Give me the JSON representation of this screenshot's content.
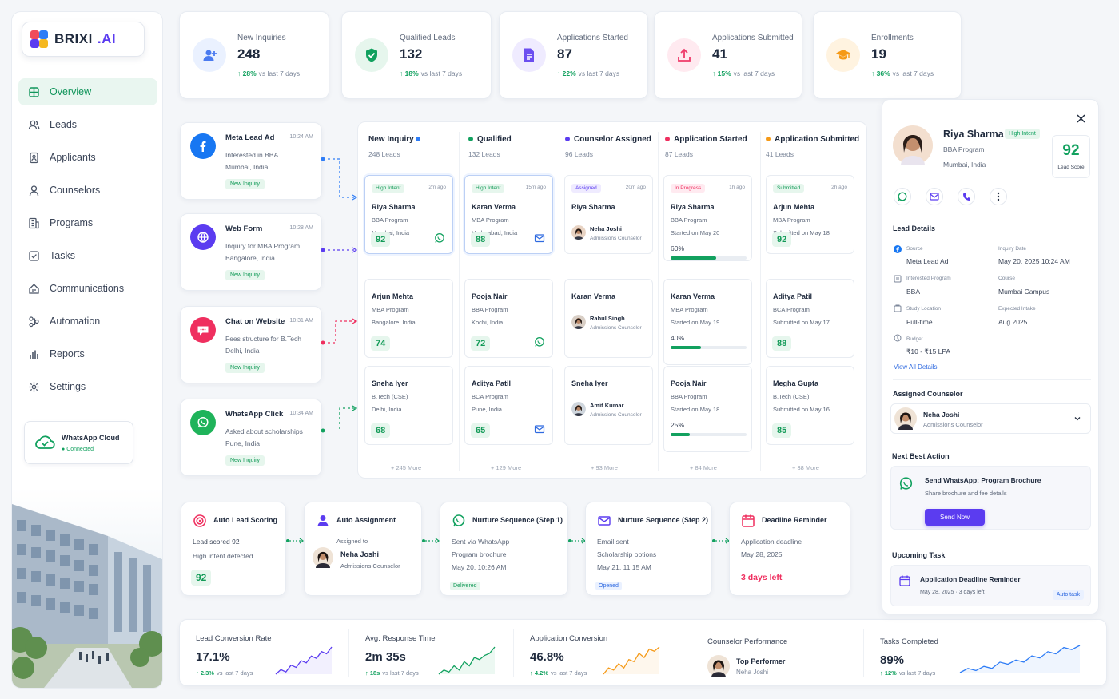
{
  "brand": {
    "name": "BRIXI",
    "suffix": ".AI"
  },
  "nav": [
    {
      "label": "Overview",
      "icon": "grid-icon",
      "active": true
    },
    {
      "label": "Leads",
      "icon": "users-icon"
    },
    {
      "label": "Applicants",
      "icon": "file-user-icon"
    },
    {
      "label": "Counselors",
      "icon": "user-icon"
    },
    {
      "label": "Programs",
      "icon": "building-icon"
    },
    {
      "label": "Tasks",
      "icon": "checkbox-icon"
    },
    {
      "label": "Communications",
      "icon": "message-icon"
    },
    {
      "label": "Automation",
      "icon": "workflow-icon"
    },
    {
      "label": "Reports",
      "icon": "bar-chart-icon"
    },
    {
      "label": "Settings",
      "icon": "gear-icon"
    }
  ],
  "whatsapp_cloud": {
    "title": "WhatsApp Cloud",
    "status": "Connected"
  },
  "kpis": [
    {
      "label": "New Inquiries",
      "value": "248",
      "delta": "28%",
      "period": "vs last 7 days",
      "icon": "user-plus-icon",
      "color": "#4a7bf0",
      "bg": "#eaf1ff"
    },
    {
      "label": "Qualified Leads",
      "value": "132",
      "delta": "18%",
      "period": "vs last 7 days",
      "icon": "shield-check-icon",
      "color": "#12a15f",
      "bg": "#e6f6ed"
    },
    {
      "label": "Applications Started",
      "value": "87",
      "delta": "22%",
      "period": "vs last 7 days",
      "icon": "document-icon",
      "color": "#6b4ef0",
      "bg": "#efebff"
    },
    {
      "label": "Applications Submitted",
      "value": "41",
      "delta": "15%",
      "period": "vs last 7 days",
      "icon": "upload-icon",
      "color": "#ef3b6a",
      "bg": "#ffeaf0"
    },
    {
      "label": "Enrollments",
      "value": "19",
      "delta": "36%",
      "period": "vs last 7 days",
      "icon": "graduation-cap-icon",
      "color": "#f59a18",
      "bg": "#fff3e0"
    }
  ],
  "sources": [
    {
      "title": "Meta Lead Ad",
      "time": "10:24 AM",
      "line1": "Interested in BBA",
      "line2": "Mumbai, India",
      "tag": "New Inquiry",
      "icon": "facebook-icon",
      "color": "#1877f2"
    },
    {
      "title": "Web Form",
      "time": "10:28 AM",
      "line1": "Inquiry for MBA Program",
      "line2": "Bangalore, India",
      "tag": "New Inquiry",
      "icon": "globe-icon",
      "color": "#5b3cf0"
    },
    {
      "title": "Chat on Website",
      "time": "10:31 AM",
      "line1": "Fees structure for B.Tech",
      "line2": "Delhi, India",
      "tag": "New Inquiry",
      "icon": "chat-icon",
      "color": "#ef2f5f"
    },
    {
      "title": "WhatsApp Click",
      "time": "10:34 AM",
      "line1": "Asked about scholarships",
      "line2": "Pune, India",
      "tag": "New Inquiry",
      "icon": "whatsapp-icon",
      "color": "#1fb35a"
    }
  ],
  "pipeline": {
    "columns": [
      {
        "title": "New Inquiry",
        "sub": "248 Leads",
        "dot": "#2f7df6",
        "more": "+ 245 More"
      },
      {
        "title": "Qualified",
        "sub": "132 Leads",
        "dot": "#12a15f",
        "more": "+ 129 More"
      },
      {
        "title": "Counselor Assigned",
        "sub": "96 Leads",
        "dot": "#5b3cf0",
        "more": "+ 93 More"
      },
      {
        "title": "Application Started",
        "sub": "87 Leads",
        "dot": "#ef2f5f",
        "more": "+ 84 More"
      },
      {
        "title": "Application Submitted",
        "sub": "41 Leads",
        "dot": "#f59a18",
        "more": "+ 38 More"
      }
    ],
    "col1": [
      {
        "tag": "High Intent",
        "ago": "2m ago",
        "name": "Riya Sharma",
        "l1": "BBA Program",
        "l2": "Mumbai, India",
        "score": "92",
        "action": "whatsapp-icon"
      },
      {
        "name": "Arjun Mehta",
        "l1": "MBA Program",
        "l2": "Bangalore, India",
        "score": "74"
      },
      {
        "name": "Sneha Iyer",
        "l1": "B.Tech (CSE)",
        "l2": "Delhi, India",
        "score": "68"
      }
    ],
    "col2": [
      {
        "tag": "High Intent",
        "ago": "15m ago",
        "name": "Karan Verma",
        "l1": "MBA Program",
        "l2": "Hyderabad, India",
        "score": "88",
        "action": "mail-icon"
      },
      {
        "name": "Pooja Nair",
        "l1": "BBA Program",
        "l2": "Kochi, India",
        "score": "72",
        "action": "whatsapp-icon"
      },
      {
        "name": "Aditya Patil",
        "l1": "BCA Program",
        "l2": "Pune, India",
        "score": "65",
        "action": "mail-icon"
      }
    ],
    "col3": [
      {
        "tag": "Assigned",
        "ago": "20m ago",
        "name": "Riya Sharma",
        "counselor": "Neha Joshi",
        "role": "Admissions Counselor"
      },
      {
        "name": "Karan Verma",
        "counselor": "Rahul Singh",
        "role": "Admissions Counselor"
      },
      {
        "name": "Sneha Iyer",
        "counselor": "Amit Kumar",
        "role": "Admissions Counselor"
      }
    ],
    "col4": [
      {
        "tag": "In Progress",
        "ago": "1h ago",
        "name": "Riya Sharma",
        "l1": "BBA Program",
        "l2": "Started on May 20",
        "pct": "60%",
        "progress": 0.6
      },
      {
        "name": "Karan Verma",
        "l1": "MBA Program",
        "l2": "Started on May 19",
        "pct": "40%",
        "progress": 0.4
      },
      {
        "name": "Pooja Nair",
        "l1": "BBA Program",
        "l2": "Started on May 18",
        "pct": "25%",
        "progress": 0.25
      }
    ],
    "col5": [
      {
        "tag": "Submitted",
        "ago": "2h ago",
        "name": "Arjun Mehta",
        "l1": "MBA Program",
        "l2": "Submitted on May 18",
        "score": "92"
      },
      {
        "name": "Aditya Patil",
        "l1": "BCA Program",
        "l2": "Submitted on May 17",
        "score": "88"
      },
      {
        "name": "Megha Gupta",
        "l1": "B.Tech (CSE)",
        "l2": "Submitted on May 16",
        "score": "85"
      }
    ]
  },
  "automation": [
    {
      "title": "Auto Lead Scoring",
      "l1": "Lead scored 92",
      "l2": "High intent detected",
      "badge": "92",
      "icon": "target-icon"
    },
    {
      "title": "Auto Assignment",
      "l1": "Assigned to",
      "name": "Neha Joshi",
      "role": "Admissions Counselor",
      "icon": "user-icon"
    },
    {
      "title": "Nurture Sequence (Step 1)",
      "l1": "Sent via WhatsApp",
      "l2": "Program brochure",
      "l3": "May 20, 10:26 AM",
      "badge": "Delivered",
      "icon": "whatsapp-icon"
    },
    {
      "title": "Nurture Sequence (Step 2)",
      "l1": "Email sent",
      "l2": "Scholarship options",
      "l3": "May 21, 11:15 AM",
      "badge": "Opened",
      "icon": "mail-icon"
    },
    {
      "title": "Deadline Reminder",
      "l1": "Application deadline",
      "l2": "May 28, 2025",
      "l3": "3 days left",
      "icon": "calendar-icon"
    }
  ],
  "metrics": [
    {
      "label": "Lead Conversion Rate",
      "value": "17.1%",
      "delta": "2.3%",
      "period": "vs last 7 days",
      "color": "#5b3cf0",
      "trend": [
        3,
        4,
        3.5,
        5,
        4.5,
        6,
        5.5,
        7,
        6.5,
        8,
        7.5,
        9
      ]
    },
    {
      "label": "Avg. Response Time",
      "value": "2m 35s",
      "delta": "18s",
      "period": "vs last 7 days",
      "color": "#12a15f",
      "trend": [
        2,
        3,
        2.5,
        4,
        3,
        5,
        4,
        6,
        5.5,
        6.5,
        7,
        8.5
      ]
    },
    {
      "label": "Application Conversion",
      "value": "46.8%",
      "delta": "4.2%",
      "period": "vs last 7 days",
      "color": "#f59a18",
      "trend": [
        2,
        3.5,
        3,
        4.5,
        3.5,
        5.5,
        5,
        7,
        6,
        8,
        7.5,
        8.5
      ]
    },
    {
      "label": "Counselor Performance",
      "top": "Top Performer",
      "name": "Neha Joshi"
    },
    {
      "label": "Tasks Completed",
      "value": "89%",
      "delta": "12%",
      "period": "vs last 7 days",
      "color": "#2f7df6",
      "trend": [
        2,
        3,
        2.5,
        3.5,
        3,
        4.5,
        4,
        5,
        4.5,
        6,
        5.5,
        7,
        6.5,
        8,
        7.5,
        8.5
      ]
    }
  ],
  "profile": {
    "name": "Riya Sharma",
    "intent": "High Intent",
    "program": "BBA Program",
    "location": "Mumbai, India",
    "score": "92",
    "score_label": "Lead Score",
    "section_details": "Lead Details",
    "source_k": "Source",
    "source_v": "Meta Lead Ad",
    "inq_k": "Inquiry Date",
    "inq_v": "May 20, 2025 10:24 AM",
    "prog_k": "Interested Program",
    "prog_v": "BBA",
    "course_k": "Course",
    "course_v": "Mumbai Campus",
    "study_k": "Study Location",
    "study_v": "Full-time",
    "intake_k": "Expected Intake",
    "intake_v": "Aug 2025",
    "budget_k": "Budget",
    "budget_v": "₹10 - ₹15 LPA",
    "view_all": "View All Details",
    "section_counselor": "Assigned Counselor",
    "counselor": "Neha Joshi",
    "counselor_role": "Admissions Counselor",
    "section_action": "Next Best Action",
    "action_title": "Send WhatsApp: Program Brochure",
    "action_sub": "Share brochure and fee details",
    "action_btn": "Send Now",
    "section_task": "Upcoming Task",
    "task_title": "Application Deadline Reminder",
    "task_date": "May 28, 2025",
    "task_left": "· 3 days left",
    "task_tag": "Auto task"
  }
}
